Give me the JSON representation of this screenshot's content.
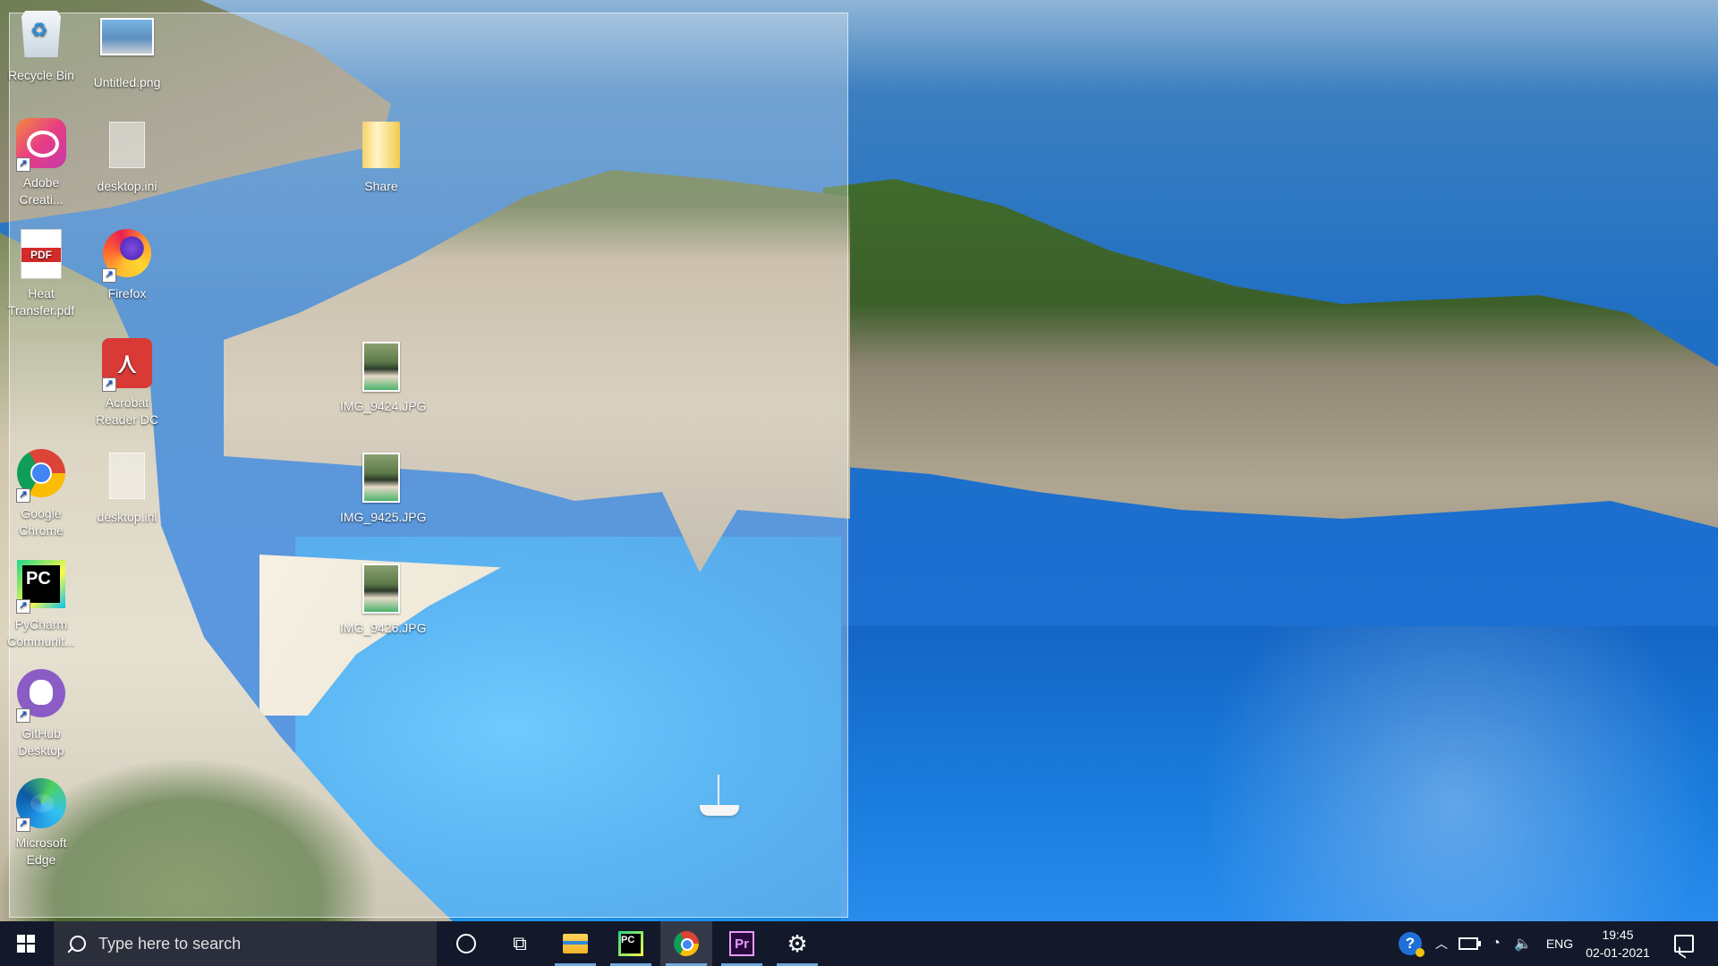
{
  "desktop": {
    "icons": [
      {
        "label": "Recycle Bin",
        "icon": "recycle-bin-icon"
      },
      {
        "label": "Untitled.png",
        "icon": "image-file-icon"
      },
      {
        "label": "Adobe Creati...",
        "icon": "adobe-creative-cloud-icon"
      },
      {
        "label": "desktop.ini",
        "icon": "settings-file-icon"
      },
      {
        "label": "Share",
        "icon": "folder-icon"
      },
      {
        "label": "Heat Transfer.pdf",
        "icon": "pdf-file-icon",
        "badge": "PDF"
      },
      {
        "label": "Firefox",
        "icon": "firefox-icon"
      },
      {
        "label": "IMG_9424.JPG",
        "icon": "photo-icon"
      },
      {
        "label": "Acrobat Reader DC",
        "icon": "acrobat-icon"
      },
      {
        "label": "Google Chrome",
        "icon": "chrome-icon"
      },
      {
        "label": "desktop.ini",
        "icon": "settings-file-icon"
      },
      {
        "label": "IMG_9425.JPG",
        "icon": "photo-icon"
      },
      {
        "label": "PyCharm Communit...",
        "icon": "pycharm-icon",
        "badge": "PC"
      },
      {
        "label": "IMG_9426.JPG",
        "icon": "photo-icon"
      },
      {
        "label": "GitHub Desktop",
        "icon": "github-desktop-icon"
      },
      {
        "label": "Microsoft Edge",
        "icon": "edge-icon"
      }
    ]
  },
  "taskbar": {
    "search_placeholder": "Type here to search",
    "apps": [
      {
        "name": "File Explorer",
        "icon": "file-explorer-icon",
        "running": true
      },
      {
        "name": "PyCharm",
        "icon": "pycharm-icon",
        "running": true
      },
      {
        "name": "Google Chrome",
        "icon": "chrome-icon",
        "running": true,
        "active": true
      },
      {
        "name": "Premiere Pro",
        "icon": "premiere-pro-icon",
        "badge": "Pr",
        "running": true
      },
      {
        "name": "Settings",
        "icon": "gear-icon",
        "running": true
      }
    ],
    "tray": {
      "language": "ENG",
      "time": "19:45",
      "date": "02-01-2021"
    }
  },
  "colors": {
    "taskbar_bg": "#13192a",
    "search_bg": "#2a2f3b",
    "running_indicator": "#6fa8dc"
  }
}
